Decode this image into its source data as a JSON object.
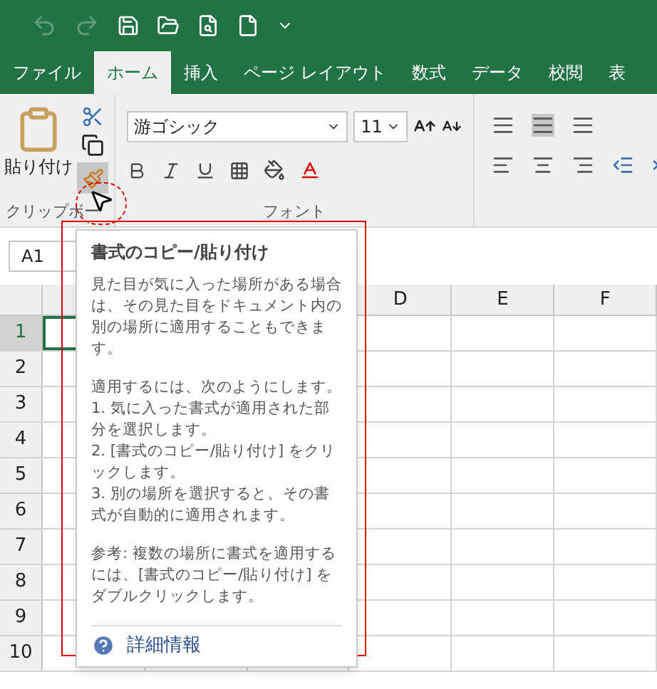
{
  "ribbon_tabs": [
    {
      "label": "ファイル",
      "selected": false
    },
    {
      "label": "ホーム",
      "selected": true
    },
    {
      "label": "挿入",
      "selected": false
    },
    {
      "label": "ページ レイアウト",
      "selected": false
    },
    {
      "label": "数式",
      "selected": false
    },
    {
      "label": "データ",
      "selected": false
    },
    {
      "label": "校閲",
      "selected": false
    },
    {
      "label": "表",
      "selected": false
    }
  ],
  "clipboard_group": {
    "paste_label": "貼り付け",
    "group_label": "クリップボー"
  },
  "font_group": {
    "font_name": "游ゴシック",
    "font_size": "11",
    "group_label": "フォント"
  },
  "name_box": "A1",
  "columns": [
    "D",
    "E",
    "F"
  ],
  "rows": [
    {
      "label": "1",
      "selected": true
    },
    {
      "label": "2",
      "selected": false
    },
    {
      "label": "3",
      "selected": false
    },
    {
      "label": "4",
      "selected": false
    },
    {
      "label": "5",
      "selected": false
    },
    {
      "label": "6",
      "selected": false
    },
    {
      "label": "7",
      "selected": false
    },
    {
      "label": "8",
      "selected": false
    },
    {
      "label": "9",
      "selected": false
    },
    {
      "label": "10",
      "selected": false
    }
  ],
  "tooltip": {
    "title": "書式のコピー/貼り付け",
    "paragraphs": [
      [
        "見た目が気に入った場所がある場合は、その見た目をドキュメント内の別の場所に適用することもできます。"
      ],
      [
        "適用するには、次のようにします。",
        "1. 気に入った書式が適用された部分を選択します。",
        "2. [書式のコピー/貼り付け] をクリックします。",
        "3. 別の場所を選択すると、その書式が自動的に適用されます。"
      ],
      [
        "参考: 複数の場所に書式を適用するには、[書式のコピー/貼り付け] をダブルクリックします。"
      ]
    ],
    "link": "詳細情報"
  }
}
